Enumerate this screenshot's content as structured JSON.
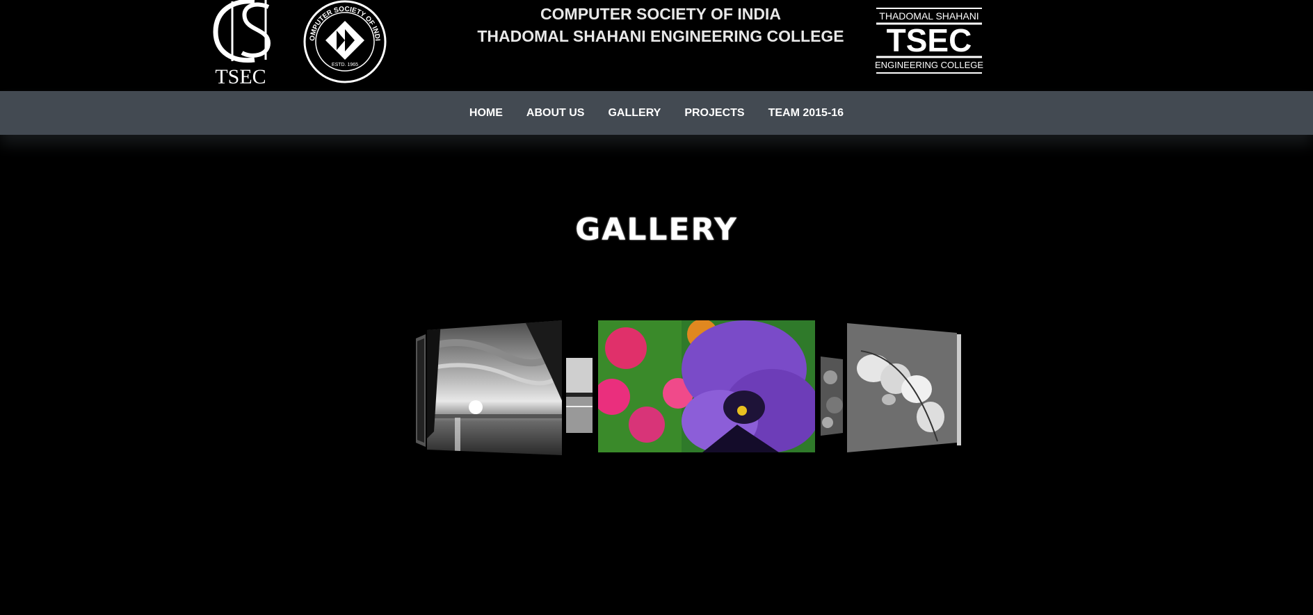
{
  "header": {
    "title_line1": "COMPUTER SOCIETY OF INDIA",
    "title_line2": "THADOMAL SHAHANI ENGINEERING COLLEGE",
    "logo_left_text": "TSEC",
    "seal_text_top": "COMPUTER SOCIETY OF INDIA",
    "seal_text_estd": "ESTD. 1965",
    "logo_right_small": "THADOMAL SHAHANI",
    "logo_right_big": "TSEC",
    "logo_right_bottom": "ENGINEERING COLLEGE"
  },
  "nav": {
    "items": [
      {
        "label": "HOME"
      },
      {
        "label": "ABOUT US"
      },
      {
        "label": "GALLERY"
      },
      {
        "label": "PROJECTS"
      },
      {
        "label": "TEAM 2015-16"
      }
    ]
  },
  "main": {
    "title": "GALLERY"
  },
  "colors": {
    "background": "#000000",
    "navbar": "#434a52",
    "text": "#ffffff"
  }
}
